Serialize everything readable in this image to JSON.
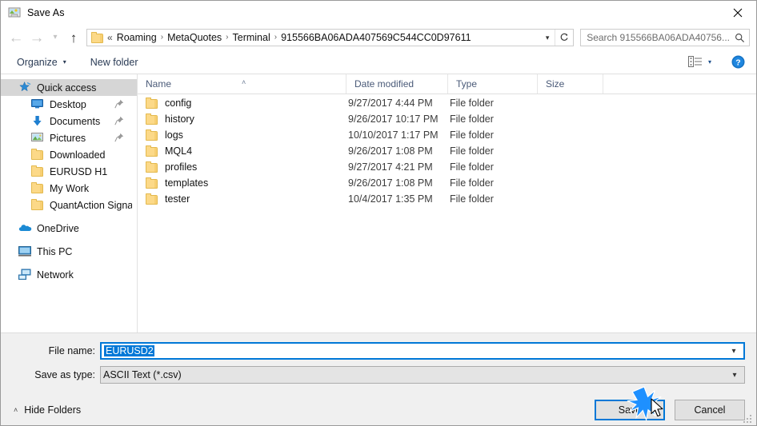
{
  "window": {
    "title": "Save As",
    "app_icon": "save-as-icon",
    "close_label": "✕"
  },
  "navigation": {
    "back": {
      "icon": "arrow-left-icon",
      "label": "←",
      "enabled": false
    },
    "forward": {
      "icon": "arrow-right-icon",
      "label": "→",
      "enabled": false
    },
    "recent": {
      "icon": "chevron-down-icon",
      "label": "⌄",
      "enabled": false
    },
    "up": {
      "icon": "arrow-up-icon",
      "label": "↑",
      "enabled": true
    },
    "address": {
      "prefix": "«",
      "crumbs": [
        "Roaming",
        "MetaQuotes",
        "Terminal",
        "915566BA06ADA407569C544CC0D97611"
      ],
      "separator": "›",
      "dropdown_icon": "chevron-down-icon",
      "refresh_icon": "refresh-icon",
      "refresh_glyph": "↻"
    },
    "search": {
      "placeholder": "Search 915566BA06ADA40756...",
      "icon": "search-icon"
    }
  },
  "commandbar": {
    "organize": "Organize",
    "organize_caret": "▼",
    "new_folder": "New folder",
    "view_icon": "view-layout-icon",
    "view_caret": "▼",
    "help_icon": "help-icon",
    "help_glyph": "?"
  },
  "sidebar": {
    "items": [
      {
        "label": "Quick access",
        "icon": "star-icon",
        "indent": 0,
        "selected": true,
        "pinned": false
      },
      {
        "label": "Desktop",
        "icon": "desktop-icon",
        "indent": 1,
        "selected": false,
        "pinned": true
      },
      {
        "label": "Documents",
        "icon": "documents-icon",
        "indent": 1,
        "selected": false,
        "pinned": true
      },
      {
        "label": "Pictures",
        "icon": "pictures-icon",
        "indent": 1,
        "selected": false,
        "pinned": true
      },
      {
        "label": "Downloaded",
        "icon": "folder-icon",
        "indent": 1,
        "selected": false,
        "pinned": false
      },
      {
        "label": "EURUSD H1",
        "icon": "folder-icon",
        "indent": 1,
        "selected": false,
        "pinned": false
      },
      {
        "label": "My Work",
        "icon": "folder-icon",
        "indent": 1,
        "selected": false,
        "pinned": false
      },
      {
        "label": "QuantAction Signal",
        "icon": "folder-icon",
        "indent": 1,
        "selected": false,
        "pinned": false
      },
      {
        "label": "OneDrive",
        "icon": "onedrive-icon",
        "indent": 0,
        "selected": false,
        "pinned": false,
        "gap_before": true
      },
      {
        "label": "This PC",
        "icon": "this-pc-icon",
        "indent": 0,
        "selected": false,
        "pinned": false,
        "gap_before": true
      },
      {
        "label": "Network",
        "icon": "network-icon",
        "indent": 0,
        "selected": false,
        "pinned": false,
        "gap_before": true
      }
    ]
  },
  "filelist": {
    "columns": [
      "Name",
      "Date modified",
      "Type",
      "Size"
    ],
    "sort_indicator": "˄",
    "rows": [
      {
        "name": "config",
        "date": "9/27/2017 4:44 PM",
        "type": "File folder",
        "size": ""
      },
      {
        "name": "history",
        "date": "9/26/2017 10:17 PM",
        "type": "File folder",
        "size": ""
      },
      {
        "name": "logs",
        "date": "10/10/2017 1:17 PM",
        "type": "File folder",
        "size": ""
      },
      {
        "name": "MQL4",
        "date": "9/26/2017 1:08 PM",
        "type": "File folder",
        "size": ""
      },
      {
        "name": "profiles",
        "date": "9/27/2017 4:21 PM",
        "type": "File folder",
        "size": ""
      },
      {
        "name": "templates",
        "date": "9/26/2017 1:08 PM",
        "type": "File folder",
        "size": ""
      },
      {
        "name": "tester",
        "date": "10/4/2017 1:35 PM",
        "type": "File folder",
        "size": ""
      }
    ]
  },
  "form": {
    "file_name_label": "File name:",
    "file_name_value": "EURUSD2",
    "save_as_type_label": "Save as type:",
    "save_as_type_value": "ASCII Text (*.csv)",
    "combo_arrow": "⌄"
  },
  "actions": {
    "hide_folders": "Hide Folders",
    "hide_folders_caret": "˄",
    "save": "Save",
    "cancel": "Cancel"
  },
  "colors": {
    "accent": "#0078d7",
    "selection": "#d6d6d6",
    "folder_yellow": "#fcd988",
    "header_text": "#4a5a78",
    "burst": "#1e90ff"
  }
}
